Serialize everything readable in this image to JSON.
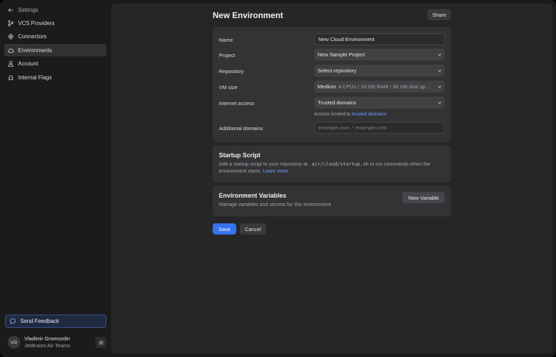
{
  "sidebar": {
    "back_label": "Settings",
    "items": [
      {
        "label": "VCS Providers",
        "icon": "vcs-icon",
        "active": false
      },
      {
        "label": "Connectors",
        "icon": "connectors-icon",
        "active": false
      },
      {
        "label": "Environments",
        "icon": "cloud-icon",
        "active": true
      },
      {
        "label": "Account",
        "icon": "user-icon",
        "active": false
      },
      {
        "label": "Internal Flags",
        "icon": "bug-icon",
        "active": false
      }
    ],
    "feedback_label": "Send Feedback",
    "user": {
      "initials": "VG",
      "name": "Vladimir Gromozdin",
      "team": "JetBrains Air Teams"
    }
  },
  "header": {
    "title": "New Environment",
    "share_label": "Share"
  },
  "form": {
    "name": {
      "label": "Name",
      "value": "New Cloud Environment"
    },
    "project": {
      "label": "Project",
      "value": "New Sample Project"
    },
    "repository": {
      "label": "Repository",
      "value": "Select repository"
    },
    "vm_size": {
      "label": "VM size",
      "value": "Medium",
      "detail": "4 CPUs / 16 GB RAM / 30 GB disk sp..."
    },
    "internet_access": {
      "label": "Internet access",
      "value": "Trusted domains",
      "hint_prefix": "Access limited to",
      "hint_link": "trusted domains"
    },
    "additional_domains": {
      "label": "Additional domains",
      "placeholder": "example.com, *.example.com"
    }
  },
  "startup": {
    "title": "Startup Script",
    "desc_before": "Add a startup script to your repository at",
    "path": ".air/cloud/startup.sh",
    "desc_after": "to run commands when the environment starts.",
    "link": "Learn more"
  },
  "env_vars": {
    "title": "Environment Variables",
    "desc": "Manage variables and secrets for this environment",
    "button": "New Variable"
  },
  "actions": {
    "save": "Save",
    "cancel": "Cancel"
  },
  "colors": {
    "accent": "#3573f0",
    "link": "#6f9cf5",
    "panel": "#333336",
    "background": "#262628"
  }
}
